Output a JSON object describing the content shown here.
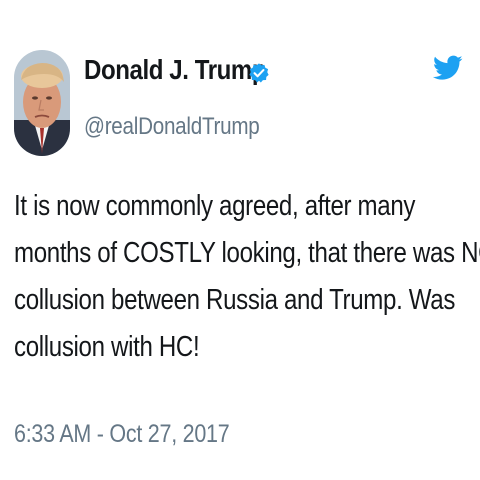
{
  "user": {
    "display_name": "Donald J. Trump",
    "handle": "@realDonaldTrump",
    "verified": true,
    "avatar_icon": "profile-photo"
  },
  "tweet": {
    "text_lines": [
      "It is now commonly agreed, after many",
      "months of COSTLY looking, that there was NO",
      "collusion between Russia and Trump. Was",
      "collusion with HC!"
    ],
    "timestamp": "6:33 AM - Oct 27, 2017"
  },
  "icons": {
    "verified": "verified-badge-icon",
    "brand": "twitter-bird-icon"
  },
  "colors": {
    "brand_blue": "#1da1f2",
    "text_primary": "#14171a",
    "text_secondary": "#657786"
  }
}
